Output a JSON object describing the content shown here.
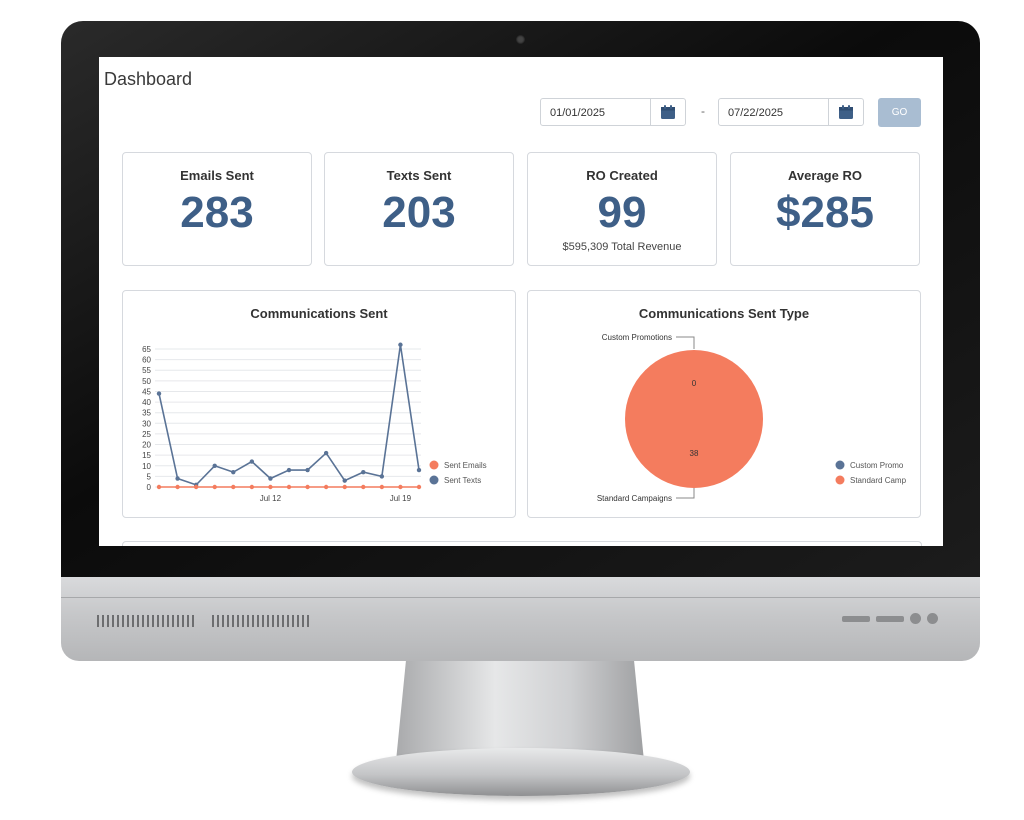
{
  "header": {
    "title": "Dashboard"
  },
  "date_range": {
    "start": "01/01/2025",
    "end": "07/22/2025",
    "separator": "-",
    "go_label": "GO"
  },
  "stats": [
    {
      "label": "Emails Sent",
      "value": "283"
    },
    {
      "label": "Texts Sent",
      "value": "203"
    },
    {
      "label": "RO Created",
      "value": "99",
      "sub": "$595,309 Total Revenue"
    },
    {
      "label": "Average RO",
      "value": "$285"
    }
  ],
  "colors": {
    "accent": "#3e5f87",
    "emails": "#f47c5e",
    "texts": "#5a7396",
    "go": "#a9bdd2"
  },
  "panels": {
    "line_title": "Communications Sent",
    "pie_title": "Communications Sent Type"
  },
  "chart_data": [
    {
      "type": "line",
      "title": "Communications Sent",
      "x_ticks": [
        "Jul 12",
        "Jul 19"
      ],
      "y_ticks": [
        0,
        5,
        10,
        15,
        20,
        25,
        30,
        35,
        40,
        45,
        50,
        55,
        60,
        65
      ],
      "ylim": [
        0,
        65
      ],
      "grid": true,
      "legend": "right",
      "series": [
        {
          "name": "Sent Emails",
          "values": [
            0,
            0,
            0,
            0,
            0,
            0,
            0,
            0,
            0,
            0,
            0,
            0,
            0,
            0,
            0
          ]
        },
        {
          "name": "Sent Texts",
          "values": [
            44,
            4,
            1,
            10,
            7,
            12,
            4,
            8,
            8,
            16,
            3,
            7,
            5,
            67,
            8
          ]
        }
      ]
    },
    {
      "type": "pie",
      "title": "Communications Sent Type",
      "legend": "right",
      "slices": [
        {
          "name": "Custom Promotions",
          "legend_label": "Custom Promo",
          "value": 0
        },
        {
          "name": "Standard Campaigns",
          "legend_label": "Standard Camp",
          "value": 38
        }
      ]
    }
  ]
}
